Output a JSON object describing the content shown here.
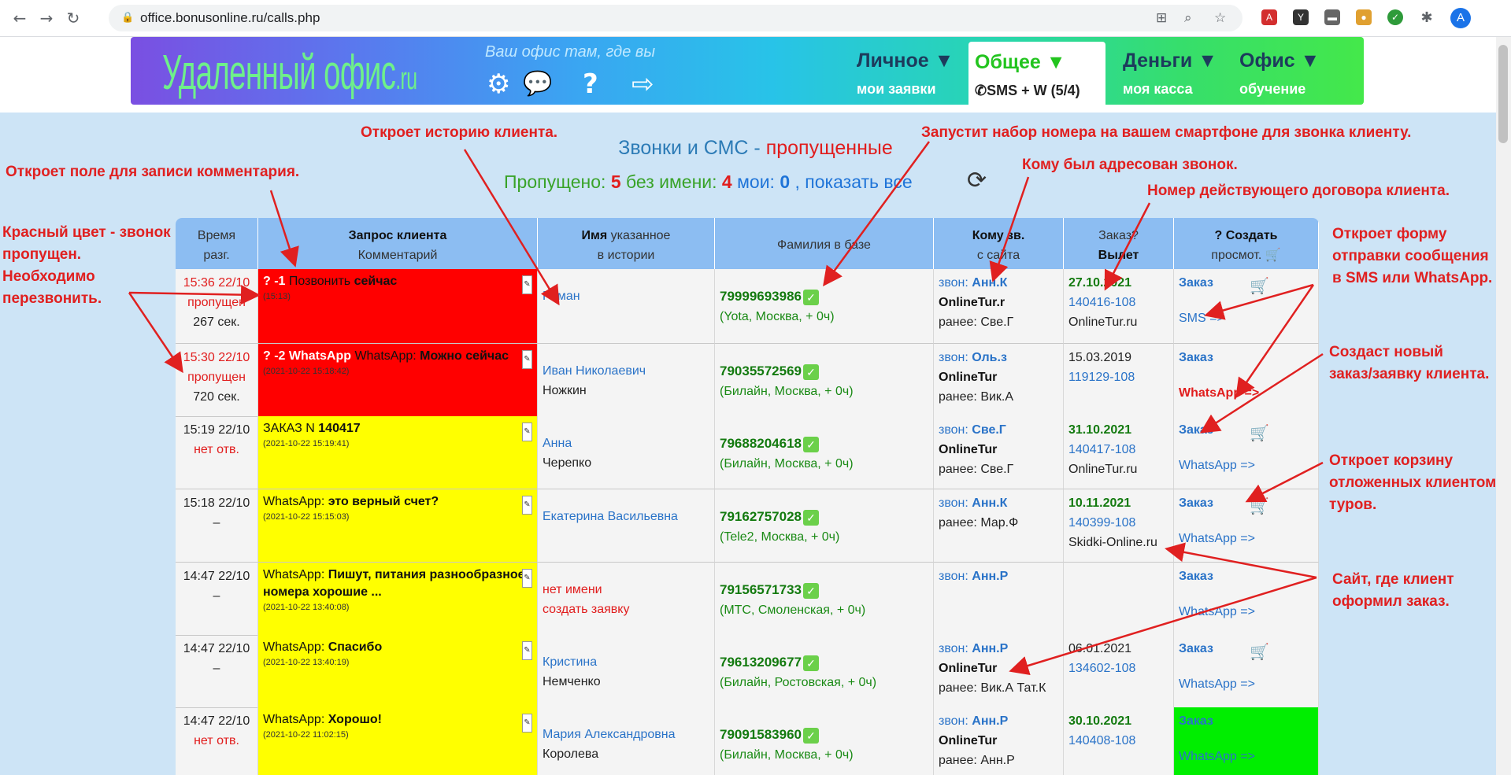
{
  "browser": {
    "url": "office.bonusonline.ru/calls.php",
    "avatar_letter": "A"
  },
  "banner": {
    "logo_text": "Удаленный офис",
    "logo_suffix": ".ru",
    "slogan": "Ваш офис там, где вы",
    "menus": [
      {
        "title": "Личное ▼",
        "sub": "мои заявки"
      },
      {
        "title": "Общее ▼",
        "sub": "SMS + W (5/4)"
      },
      {
        "title": "Деньги ▼",
        "sub": "моя касса"
      },
      {
        "title": "Офис ▼",
        "sub": "обучение"
      }
    ]
  },
  "page": {
    "title_main": "Звонки и СМС - ",
    "title_red": "пропущенные",
    "stats": {
      "missed_label": "Пропущено:",
      "missed_count": "5",
      "no_name_label": "без имени:",
      "no_name_count": "4",
      "mine_label": "мои:",
      "mine_count": "0",
      "show_all": ", показать все"
    }
  },
  "table": {
    "headers": {
      "time": [
        "Время",
        "разг."
      ],
      "request": [
        "Запрос клиента",
        "Комментарий"
      ],
      "name": [
        "Имя",
        "указанное",
        "в истории"
      ],
      "surname": "Фамилия в базе",
      "to": [
        "Кому зв.",
        "с сайта"
      ],
      "order": [
        "Заказ?",
        "Вылет"
      ],
      "create": [
        "? Создать",
        "просмот."
      ]
    },
    "rows": [
      {
        "time": "15:36 22/10",
        "status": "пропущен",
        "dur": "267 сек.",
        "req_prefix": "? -1",
        "req_text": "Позвонить ",
        "req_bold": "сейчас",
        "req_ts": "(15:13)",
        "name1": "Роман",
        "name2": "",
        "phone": "79999693986",
        "op": "(Yota, Москва, + 0ч)",
        "to_zv": "звон: ",
        "to_name": "Анн.К",
        "to_site": "OnlineTur.r",
        "to_prev": "ранее: Све.Г",
        "ord_date": "27.10.2021",
        "ord_num": "140416-108",
        "ord_site": "OnlineTur.ru",
        "act1": "Заказ",
        "act2": "SMS =>"
      },
      {
        "time": "15:30 22/10",
        "status": "пропущен",
        "dur": "720 сек.",
        "req_prefix": "? -2 WhatsApp",
        "req_text": "WhatsApp: ",
        "req_bold": "Можно сейчас",
        "req_ts": "(2021-10-22 15:18:42)",
        "name1": "Иван Николаевич",
        "name2": "Ножкин",
        "phone": "79035572569",
        "op": "(Билайн, Москва, + 0ч)",
        "to_zv": "звон: ",
        "to_name": "Оль.з",
        "to_site": "OnlineTur",
        "to_prev": "ранее: Вик.А",
        "ord_date": "15.03.2019",
        "ord_num": "119129-108",
        "ord_site": "",
        "act1": "Заказ",
        "act2": "WhatsApp =>"
      },
      {
        "time": "15:19 22/10",
        "status": "нет отв.",
        "dur": "",
        "req_prefix": "",
        "req_text": "ЗАКАЗ N ",
        "req_bold": "140417",
        "req_ts": "(2021-10-22 15:19:41)",
        "name1": "Анна",
        "name2": "Черепко",
        "phone": "79688204618",
        "op": "(Билайн, Москва, + 0ч)",
        "to_zv": "звон: ",
        "to_name": "Све.Г",
        "to_site": "OnlineTur",
        "to_prev": "ранее: Све.Г",
        "ord_date": "31.10.2021",
        "ord_num": "140417-108",
        "ord_site": "OnlineTur.ru",
        "act1": "Заказ",
        "act2": "WhatsApp =>"
      },
      {
        "time": "15:18 22/10",
        "status": "",
        "dur": "–",
        "req_prefix": "",
        "req_text": "WhatsApp: ",
        "req_bold": "это верный счет?",
        "req_ts": "(2021-10-22 15:15:03)",
        "name1": "Екатерина Васильевна",
        "name2": "",
        "phone": "79162757028",
        "op": "(Tele2, Москва, + 0ч)",
        "to_zv": "звон: ",
        "to_name": "Анн.К",
        "to_site": "",
        "to_prev": "ранее: Мар.Ф",
        "ord_date": "10.11.2021",
        "ord_num": "140399-108",
        "ord_site": "Skidki-Online.ru",
        "act1": "Заказ",
        "act2": "WhatsApp =>"
      },
      {
        "time": "14:47 22/10",
        "status": "",
        "dur": "–",
        "req_prefix": "",
        "req_text": "WhatsApp: ",
        "req_bold": "Пишут, питания разнообразное, номера хорошие ...",
        "req_ts": "(2021-10-22 13:40:08)",
        "name1": "нет имени",
        "name2": "создать заявку",
        "phone": "79156571733",
        "op": "(МТС, Смоленская, + 0ч)",
        "to_zv": "звон: ",
        "to_name": "Анн.Р",
        "to_site": "",
        "to_prev": "",
        "ord_date": "",
        "ord_num": "",
        "ord_site": "",
        "act1": "Заказ",
        "act2": "WhatsApp =>"
      },
      {
        "time": "14:47 22/10",
        "status": "",
        "dur": "–",
        "req_prefix": "",
        "req_text": "WhatsApp: ",
        "req_bold": "Спасибо",
        "req_ts": "(2021-10-22 13:40:19)",
        "name1": "Кристина",
        "name2": "Немченко",
        "phone": "79613209677",
        "op": "(Билайн, Ростовская, + 0ч)",
        "to_zv": "звон: ",
        "to_name": "Анн.Р",
        "to_site": "OnlineTur",
        "to_prev": "ранее: Вик.А Тат.К",
        "ord_date": "06.01.2021",
        "ord_num": "134602-108",
        "ord_site": "",
        "act1": "Заказ",
        "act2": "WhatsApp =>"
      },
      {
        "time": "14:47 22/10",
        "status": "нет отв.",
        "dur": "",
        "req_prefix": "",
        "req_text": "WhatsApp: ",
        "req_bold": "Хорошо!",
        "req_ts": "(2021-10-22 11:02:15)",
        "name1": "Мария Александровна",
        "name2": "Королева",
        "phone": "79091583960",
        "op": "(Билайн, Москва, + 0ч)",
        "to_zv": "звон: ",
        "to_name": "Анн.Р",
        "to_site": "OnlineTur",
        "to_prev": "ранее: Анн.Р",
        "ord_date": "30.10.2021",
        "ord_num": "140408-108",
        "ord_site": "",
        "act1": "Заказ",
        "act2": "WhatsApp =>"
      }
    ]
  },
  "annotations": {
    "a1": "Откроет историю клиента.",
    "a2": "Запустит набор номера на вашем смартфоне для звонка клиенту.",
    "a3": "Кому был адресован звонок.",
    "a4": "Номер действующего договора клиента.",
    "a5": "Откроет поле для записи комментария.",
    "a6": [
      "Красный цвет - звонок",
      "пропущен.",
      "Необходимо",
      "перезвонить."
    ],
    "a7": [
      "Откроет форму",
      "отправки сообщения",
      "в SMS или WhatsApp."
    ],
    "a8": [
      "Создаст новый",
      "заказ/заявку клиента."
    ],
    "a9": [
      "Откроет корзину",
      "отложенных клиентом",
      "туров."
    ],
    "a10": [
      "Сайт, где клиент",
      "оформил заказ."
    ]
  },
  "colors": {
    "missed_row": "#ff0000",
    "pending_row": "#ffff00",
    "header": "#8cbdf2",
    "annotation": "#e02020",
    "highlight_green": "#00ee00"
  }
}
